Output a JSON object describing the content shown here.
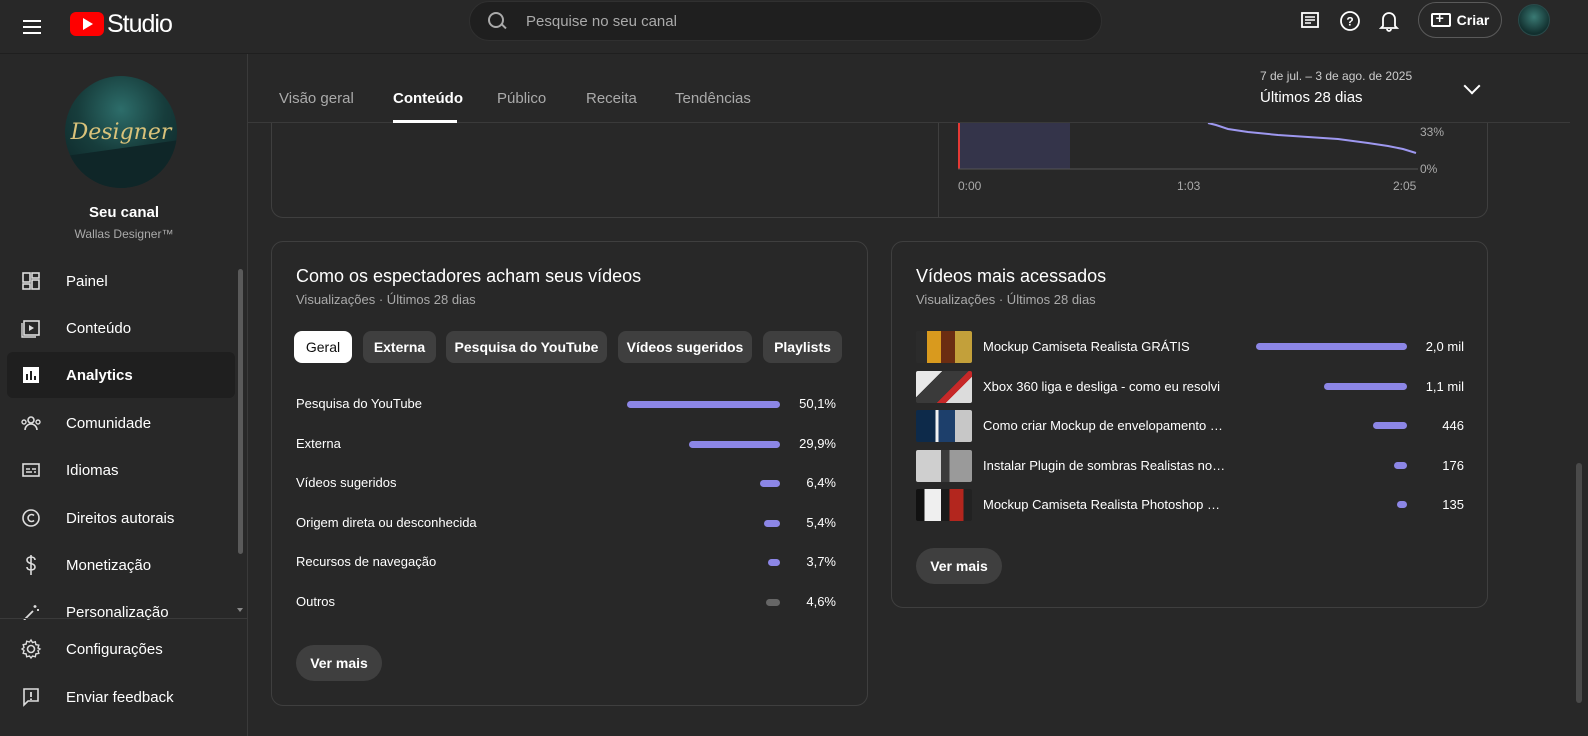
{
  "app": {
    "logo_text": "Studio"
  },
  "search": {
    "placeholder": "Pesquise no seu canal"
  },
  "header": {
    "create_label": "Criar"
  },
  "channel": {
    "title": "Seu canal",
    "name": "Wallas Designer™",
    "avatar_text": "Designer"
  },
  "sidebar": {
    "items": [
      {
        "label": "Painel",
        "icon": "dashboard-icon",
        "active": false
      },
      {
        "label": "Conteúdo",
        "icon": "content-icon",
        "active": false
      },
      {
        "label": "Analytics",
        "icon": "analytics-icon",
        "active": true
      },
      {
        "label": "Comunidade",
        "icon": "community-icon",
        "active": false
      },
      {
        "label": "Idiomas",
        "icon": "subtitles-icon",
        "active": false
      },
      {
        "label": "Direitos autorais",
        "icon": "copyright-icon",
        "active": false
      },
      {
        "label": "Monetização",
        "icon": "dollar-icon",
        "active": false
      },
      {
        "label": "Personalização",
        "icon": "magic-wand-icon",
        "active": false
      }
    ],
    "bottom": [
      {
        "label": "Configurações",
        "icon": "gear-icon"
      },
      {
        "label": "Enviar feedback",
        "icon": "feedback-icon"
      }
    ]
  },
  "tabs": [
    {
      "label": "Visão geral",
      "active": false
    },
    {
      "label": "Conteúdo",
      "active": true
    },
    {
      "label": "Público",
      "active": false
    },
    {
      "label": "Receita",
      "active": false
    },
    {
      "label": "Tendências",
      "active": false
    }
  ],
  "date_range": {
    "dates": "7 de jul. – 3 de ago. de 2025",
    "label": "Últimos 28 dias"
  },
  "retention_chart": {
    "y_labels": [
      "33%",
      "0%"
    ],
    "x_labels": [
      "0:00",
      "1:03",
      "2:05"
    ]
  },
  "traffic_sources": {
    "title": "Como os espectadores acham seus vídeos",
    "subtitle": "Visualizações · Últimos 28 dias",
    "chips": [
      {
        "label": "Geral",
        "active": true
      },
      {
        "label": "Externa",
        "active": false
      },
      {
        "label": "Pesquisa do YouTube",
        "active": false
      },
      {
        "label": "Vídeos sugeridos",
        "active": false
      },
      {
        "label": "Playlists",
        "active": false
      }
    ],
    "rows": [
      {
        "label": "Pesquisa do YouTube",
        "value": "50,1%",
        "pct": 50.1,
        "color": "#8c86e6"
      },
      {
        "label": "Externa",
        "value": "29,9%",
        "pct": 29.9,
        "color": "#8c86e6"
      },
      {
        "label": "Vídeos sugeridos",
        "value": "6,4%",
        "pct": 6.4,
        "color": "#8c86e6"
      },
      {
        "label": "Origem direta ou desconhecida",
        "value": "5,4%",
        "pct": 5.4,
        "color": "#8c86e6"
      },
      {
        "label": "Recursos de navegação",
        "value": "3,7%",
        "pct": 3.7,
        "color": "#8c86e6"
      },
      {
        "label": "Outros",
        "value": "4,6%",
        "pct": 4.6,
        "color": "#666666"
      }
    ],
    "more_label": "Ver mais"
  },
  "top_videos": {
    "title": "Vídeos mais acessados",
    "subtitle": "Visualizações · Últimos 28 dias",
    "rows": [
      {
        "title": "Mockup Camiseta Realista GRÁTIS",
        "value": "2,0 mil",
        "views": 2000
      },
      {
        "title": "Xbox 360 liga e desliga - como eu resolvi",
        "value": "1,1 mil",
        "views": 1100
      },
      {
        "title": "Como criar Mockup de envelopamento de veículos",
        "value": "446",
        "views": 446
      },
      {
        "title": "Instalar Plugin de sombras Realistas no Photoshop",
        "value": "176",
        "views": 176
      },
      {
        "title": "Mockup Camiseta Realista Photoshop PSD",
        "value": "135",
        "views": 135
      }
    ],
    "more_label": "Ver mais"
  },
  "colors": {
    "accent": "#8c86e6",
    "background": "#282828",
    "brand": "#ff0000"
  }
}
